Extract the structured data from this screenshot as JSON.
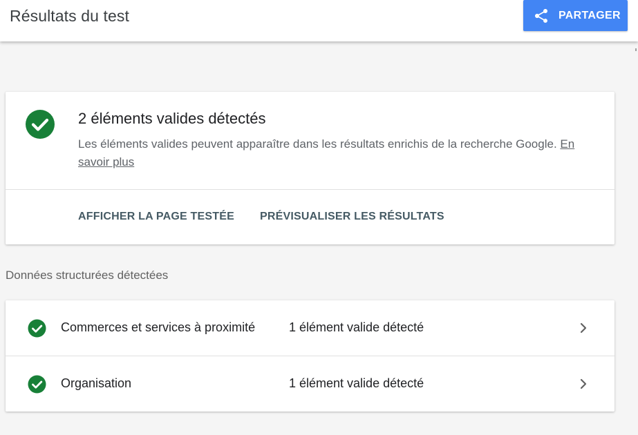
{
  "header": {
    "title": "Résultats du test",
    "share_label": "PARTAGER"
  },
  "summary": {
    "title": "2 éléments valides détectés",
    "description": "Les éléments valides peuvent apparaître dans les résultats enrichis de la recherche Google.",
    "learn_more": "En savoir plus",
    "actions": [
      "AFFICHER LA PAGE TESTÉE",
      "PRÉVISUALISER LES RÉSULTATS"
    ]
  },
  "structured_data": {
    "heading": "Données structurées détectées",
    "items": [
      {
        "name": "Commerces et services à proximité",
        "status": "1 élément valide détecté"
      },
      {
        "name": "Organisation",
        "status": "1 élément valide détecté"
      }
    ]
  },
  "colors": {
    "accent": "#4285f4",
    "valid": "#188038",
    "action_text": "#455a64"
  },
  "icons": {
    "share": "share-icon",
    "valid": "check-circle-icon",
    "row_open": "chevron-right-icon"
  }
}
